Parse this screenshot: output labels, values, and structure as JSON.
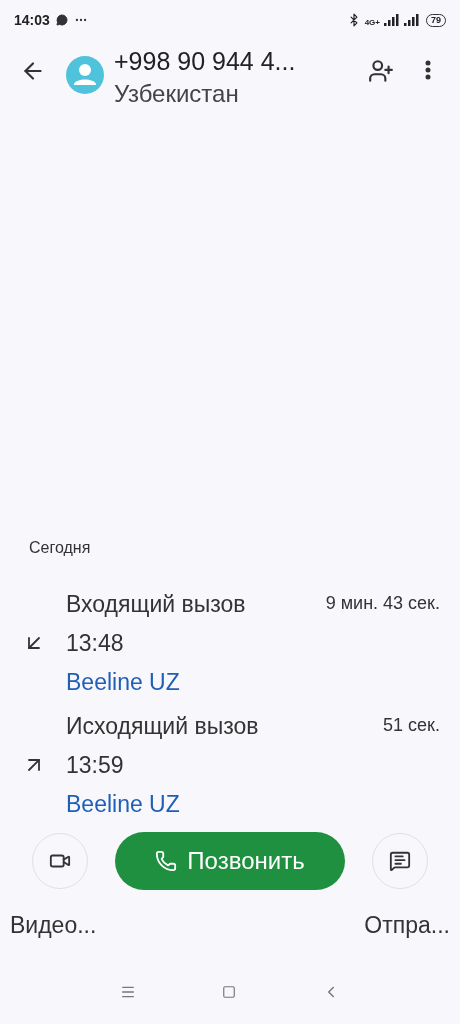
{
  "status_bar": {
    "time": "14:03",
    "network": "4G+",
    "battery": "79"
  },
  "header": {
    "title": "+998 90 944 4...",
    "subtitle": "Узбекистан"
  },
  "section": "Сегодня",
  "calls": [
    {
      "kind": "incoming",
      "label": "Входящий вызов",
      "time": "13:48",
      "duration": "9 мин. 43 сек.",
      "carrier": "Beeline UZ"
    },
    {
      "kind": "outgoing",
      "label": "Исходящий вызов",
      "time": "13:59",
      "duration": "51 сек.",
      "carrier": "Beeline UZ"
    }
  ],
  "actions": {
    "video_label": "Видео...",
    "call_label": "Позвонить",
    "message_label": "Отпра..."
  }
}
